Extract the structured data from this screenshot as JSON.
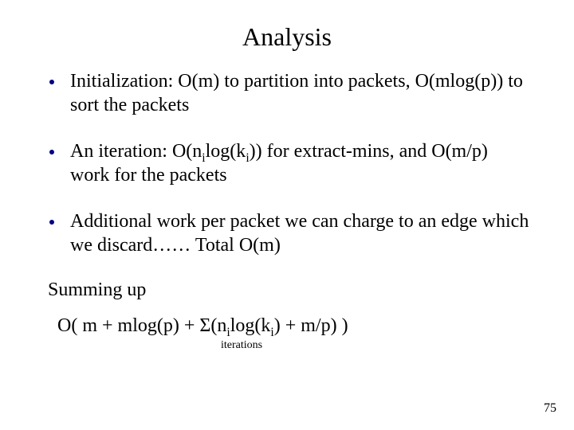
{
  "title": "Analysis",
  "bullets": [
    {
      "pre": "Initialization: O(m) to partition into packets, O(mlog(p)) to sort the packets"
    },
    {
      "pre": "An iteration: O(n",
      "sub1": "i",
      "mid1": "log(k",
      "sub2": "i",
      "post1": ")) for extract-mins, and O(m/p) work for the packets"
    },
    {
      "pre": "Additional work per packet we can charge to an edge which we discard…… Total O(m)"
    }
  ],
  "summing_label": "Summing up",
  "formula": {
    "a": "O( m + mlog(p) + Σ",
    "b": "(n",
    "sub1": "i",
    "c": "log(k",
    "sub2": "i",
    "d": ") + m/p) )"
  },
  "iterations_label": "iterations",
  "page_number": "75"
}
